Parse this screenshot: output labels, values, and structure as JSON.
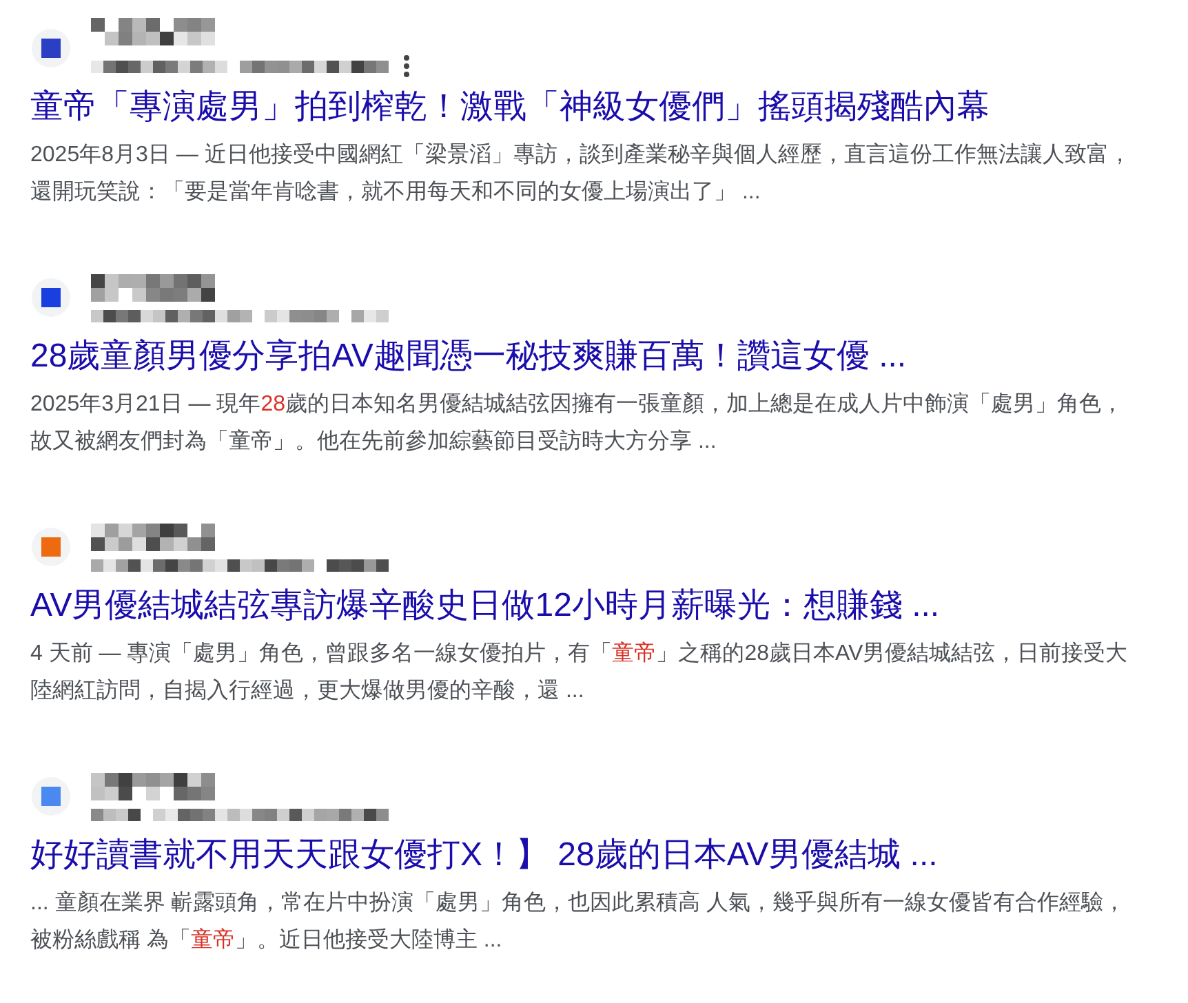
{
  "results": [
    {
      "color": "#2a3fc4",
      "menu": true,
      "title": "童帝「專演處男」拍到榨乾！激戰「神級女優們」搖頭揭殘酷內幕",
      "snippet": [
        {
          "text": "2025年8月3日 — 近日他接受中國網紅「梁景滔」專訪，談到產業秘辛與個人經歷，直言這份工作無法讓人致富，還開玩笑說：「要是當年肯唸書，就不用每天和不同的女優上場演出了」 ...",
          "highlight": false
        }
      ]
    },
    {
      "color": "#1a3fe0",
      "menu": false,
      "title": "28歲童顏男優分享拍AV趣聞憑一秘技爽賺百萬！讚這女優 ...",
      "snippet": [
        {
          "text": "2025年3月21日 — 現年",
          "highlight": false
        },
        {
          "text": "28",
          "highlight": true
        },
        {
          "text": "歲的日本知名男優結城結弦因擁有一張童顏，加上總是在成人片中飾演「處男」角色，故又被網友們封為「童帝」。他在先前參加綜藝節目受訪時大方分享 ...",
          "highlight": false
        }
      ]
    },
    {
      "color": "#ee6a10",
      "menu": false,
      "title": "AV男優結城結弦專訪爆辛酸史日做12小時月薪曝光：想賺錢 ...",
      "snippet": [
        {
          "text": "4 天前 — 專演「處男」角色，曾跟多名一線女優拍片，有「",
          "highlight": false
        },
        {
          "text": "童帝",
          "highlight": true
        },
        {
          "text": "」之稱的28歲日本AV男優結城結弦，日前接受大陸網紅訪問，自揭入行經過，更大爆做男優的辛酸，還 ...",
          "highlight": false
        }
      ]
    },
    {
      "color": "#4a8af0",
      "menu": false,
      "title": "好好讀書就不用天天跟女優打X！】 28歲的日本AV男優結城 ...",
      "snippet": [
        {
          "text": "... 童顏在業界 嶄露頭角，常在片中扮演「處男」角色，也因此累積高 人氣，幾乎與所有一線女優皆有合作經驗，被粉絲戲稱 為「",
          "highlight": false
        },
        {
          "text": "童帝",
          "highlight": true
        },
        {
          "text": "」。近日他接受大陸博主 ...",
          "highlight": false
        }
      ]
    }
  ]
}
